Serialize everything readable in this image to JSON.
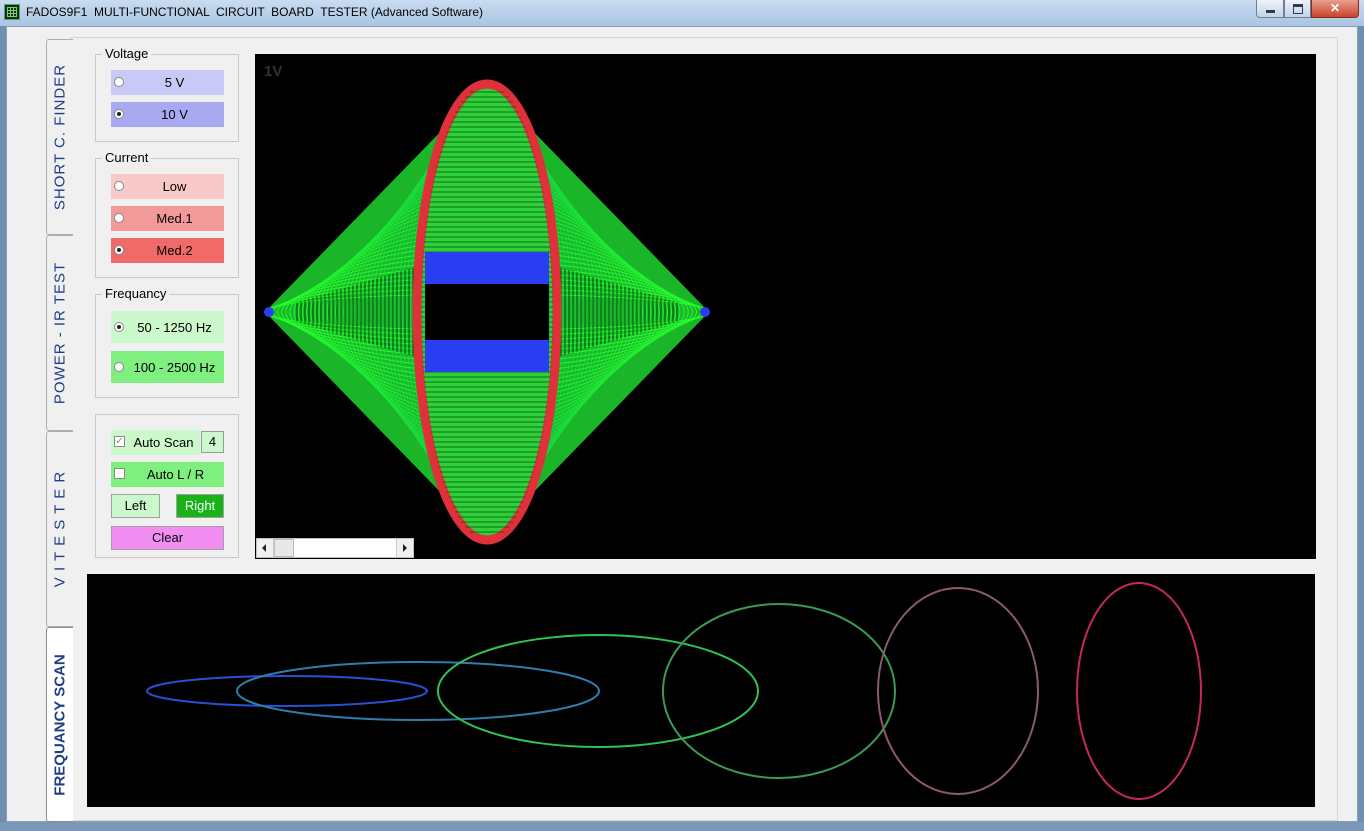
{
  "window": {
    "title": "FADOS9F1  MULTI-FUNCTIONAL  CIRCUIT  BOARD  TESTER (Advanced Software)"
  },
  "tabs": [
    {
      "label": "SHORT  C. FINDER",
      "active": false
    },
    {
      "label": "POWER - IR TEST",
      "active": false
    },
    {
      "label": "V I   T E S T E R",
      "active": false
    },
    {
      "label": "FREQUANCY SCAN",
      "active": true
    }
  ],
  "voltage": {
    "title": "Voltage",
    "options": [
      {
        "label": "5 V",
        "selected": false,
        "color": "#c9c9f7"
      },
      {
        "label": "10 V",
        "selected": true,
        "color": "#a9a9f1"
      }
    ]
  },
  "current": {
    "title": "Current",
    "options": [
      {
        "label": "Low",
        "selected": false,
        "color": "#f9c9c9"
      },
      {
        "label": "Med.1",
        "selected": false,
        "color": "#f29a9a"
      },
      {
        "label": "Med.2",
        "selected": true,
        "color": "#f06a6a"
      }
    ]
  },
  "frequency": {
    "title": "Frequancy",
    "options": [
      {
        "label": "50 - 1250 Hz",
        "selected": true,
        "color": "#ccf9cc"
      },
      {
        "label": "100 - 2500 Hz",
        "selected": false,
        "color": "#7fef7f"
      }
    ]
  },
  "scan": {
    "auto_scan_label": "Auto Scan",
    "auto_scan_checked": true,
    "auto_scan_count": "4",
    "auto_lr_label": "Auto L / R",
    "auto_lr_checked": false,
    "left_label": "Left",
    "right_label": "Right",
    "clear_label": "Clear"
  },
  "vi_display": {
    "scale_label": "1V"
  },
  "colors": {
    "display_bg": "#000000",
    "trace_red": "#e0303a",
    "trace_green": "#2ee82e",
    "trace_blue": "#2a3df0",
    "right_button": "#17b317",
    "clear_button": "#f28ef2"
  }
}
